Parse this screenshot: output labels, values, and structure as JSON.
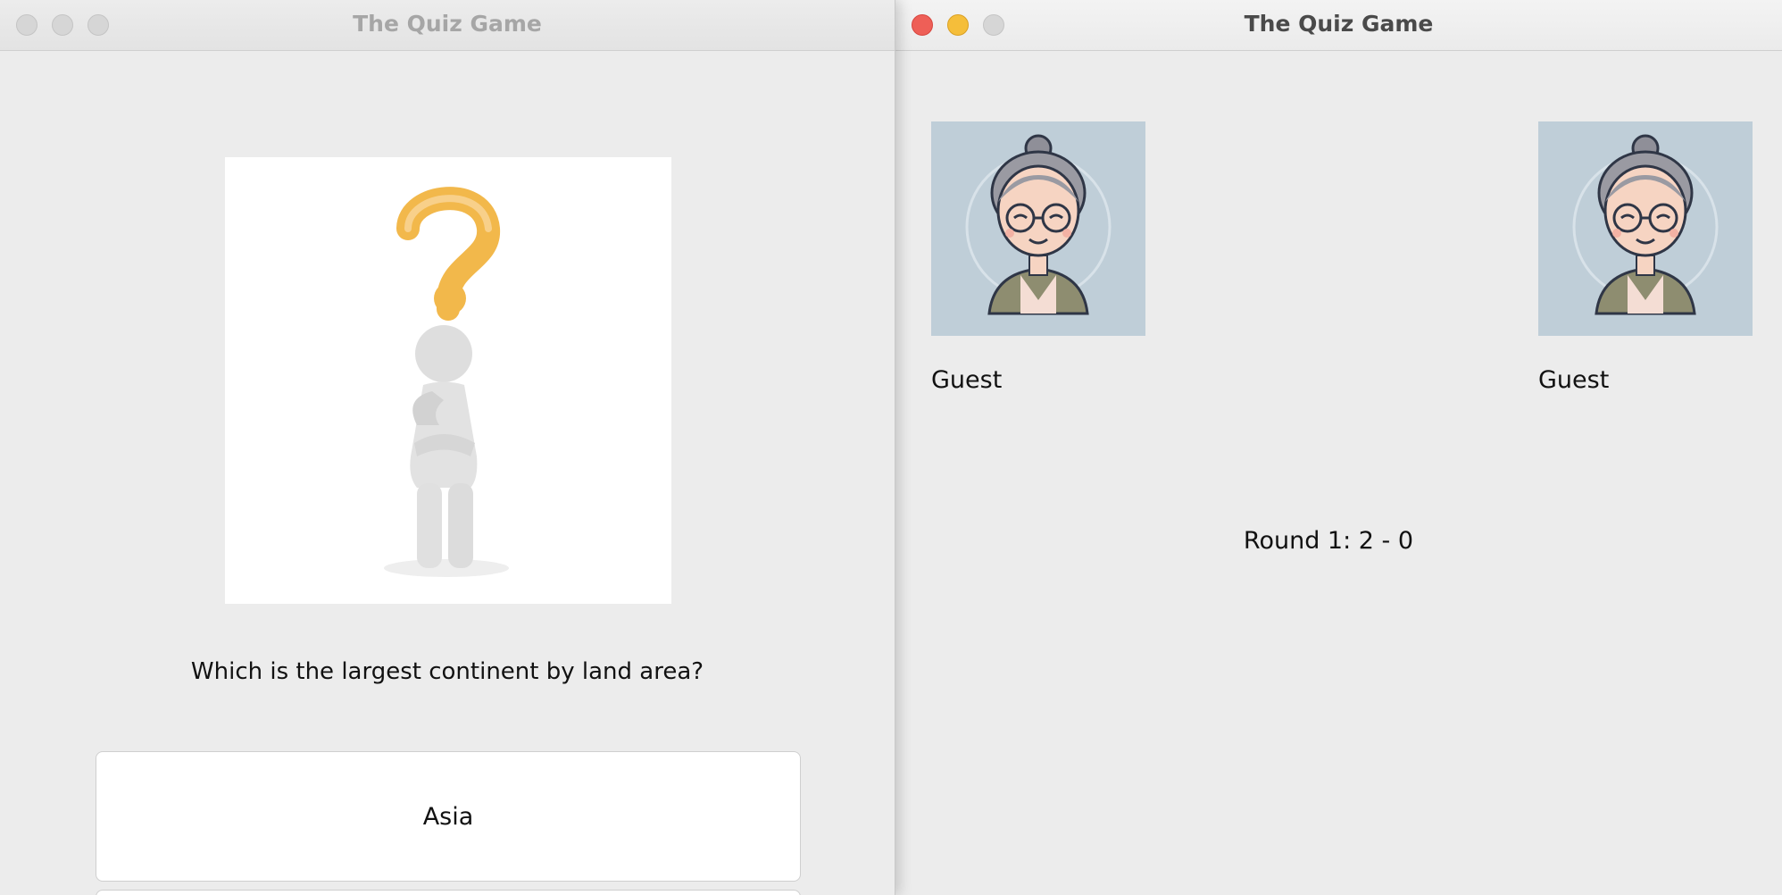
{
  "left_window": {
    "title": "The Quiz Game",
    "question": "Which is the largest continent by land area?",
    "answers": [
      "Asia"
    ]
  },
  "right_window": {
    "title": "The Quiz Game",
    "player1": {
      "name": "Guest"
    },
    "player2": {
      "name": "Guest"
    },
    "score_text": "Round 1: 2 - 0"
  },
  "colors": {
    "close": "#ee5f57",
    "minimize": "#f5be3a",
    "question_mark": "#f2b84b",
    "avatar_bg": "#bfced8"
  }
}
